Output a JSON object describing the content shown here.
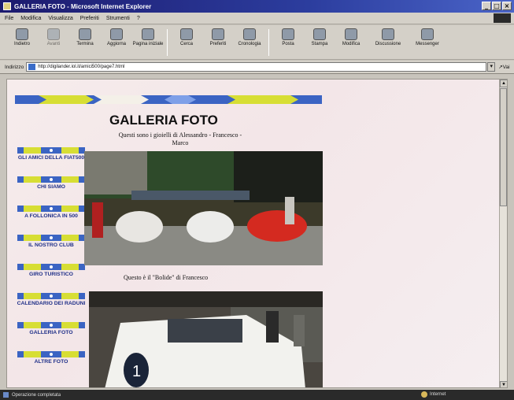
{
  "window": {
    "title": "GALLERIA FOTO - Microsoft Internet Explorer"
  },
  "menu": [
    "File",
    "Modifica",
    "Visualizza",
    "Preferiti",
    "Strumenti",
    "?"
  ],
  "toolbar": {
    "buttons": [
      {
        "label": "Indietro",
        "icon": "back-arrow-icon"
      },
      {
        "label": "Avanti",
        "icon": "forward-arrow-icon"
      },
      {
        "label": "Termina",
        "icon": "stop-icon"
      },
      {
        "label": "Aggiorna",
        "icon": "refresh-icon"
      },
      {
        "label": "Pagina iniziale",
        "icon": "home-icon"
      },
      {
        "label": "Cerca",
        "icon": "search-icon"
      },
      {
        "label": "Preferiti",
        "icon": "favorites-icon"
      },
      {
        "label": "Cronologia",
        "icon": "history-icon"
      },
      {
        "label": "Posta",
        "icon": "mail-icon"
      },
      {
        "label": "Stampa",
        "icon": "print-icon"
      },
      {
        "label": "Modifica",
        "icon": "edit-icon"
      },
      {
        "label": "Discussione",
        "icon": "discuss-icon"
      },
      {
        "label": "Messenger",
        "icon": "messenger-icon"
      }
    ]
  },
  "address": {
    "label": "Indirizzo",
    "url": "http://digilander.iol.it/amici500/page7.html",
    "go_label": "Vai"
  },
  "page": {
    "title": "GALLERIA FOTO",
    "subtitle": "Questi sono i gioielli di Alessandro - Francesco -Marco",
    "nav": [
      "GLI AMICI DELLA FIAT500",
      "CHI SIAMO",
      "A FOLLONICA IN 500",
      "IL NOSTRO CLUB",
      "GIRO TURISTICO",
      "CALENDARIO DEI RADUNI",
      "GALLERIA FOTO",
      "ALTRE FOTO"
    ],
    "caption2": "Questo è il \"Bolide\" di Francesco"
  },
  "status": {
    "text": "Operazione completata",
    "zone": "Internet"
  },
  "colors": {
    "stripe_yellow": "#d7de34",
    "stripe_blue": "#3b64c3",
    "nav_text": "#1f2f88"
  }
}
